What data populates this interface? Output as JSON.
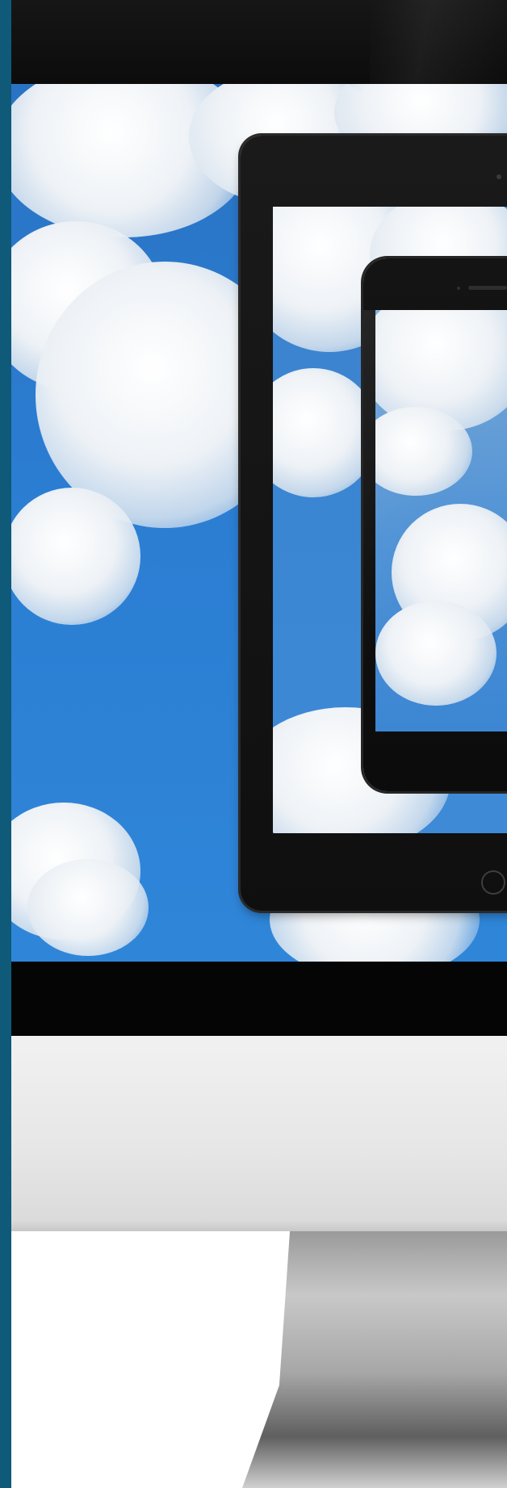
{
  "scene": {
    "description_labels": {
      "left_strip": "left-accent-strip",
      "imac": "imac-monitor",
      "tablet": "tablet-device",
      "phone": "phone-device"
    },
    "colors": {
      "accent_strip": "#0e5a78",
      "sky_blue": "#2b7dd2",
      "bezel_black": "#050505",
      "chin_silver": "#e6e6e6",
      "background": "#ffffff"
    }
  }
}
